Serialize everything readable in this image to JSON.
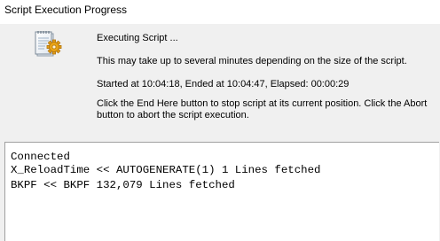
{
  "window": {
    "title": "Script Execution Progress"
  },
  "icons": {
    "script": "script-document-icon"
  },
  "message": {
    "executing": "Executing Script ...",
    "duration_note": "This may take up to several minutes depending on the size of the script.",
    "timing": "Started at 10:04:18, Ended at 10:04:47,  Elapsed: 00:00:29",
    "instructions": "Click the End Here button to stop script at its current position. Click the Abort button to abort the script execution."
  },
  "log": {
    "lines": [
      "Connected",
      "X_ReloadTime << AUTOGENERATE(1) 1 Lines fetched",
      "BKPF << BKPF 132,079 Lines fetched"
    ]
  },
  "colors": {
    "dialog_background": "#f0f0f0",
    "log_background": "#ffffff",
    "icon_paper": "#ffffff",
    "icon_gear": "#e8a317"
  }
}
